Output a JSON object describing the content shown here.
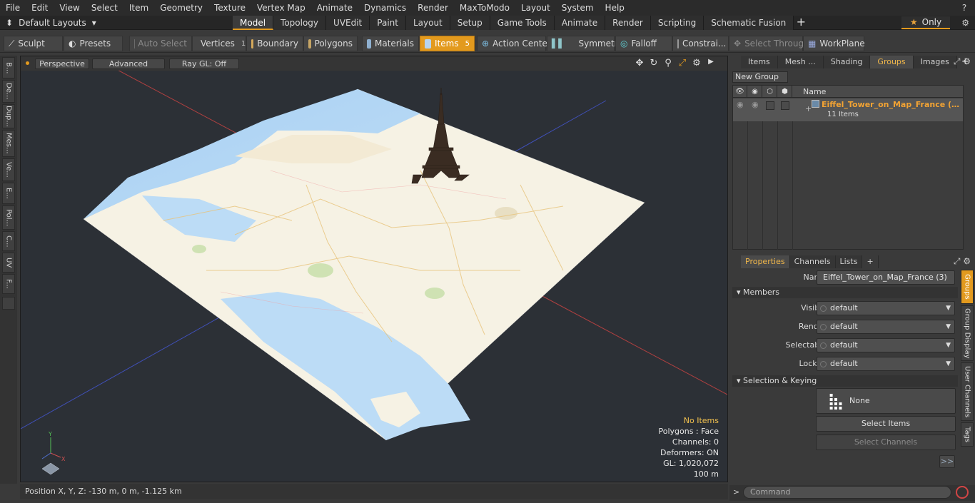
{
  "menu": [
    "File",
    "Edit",
    "View",
    "Select",
    "Item",
    "Geometry",
    "Texture",
    "Vertex Map",
    "Animate",
    "Dynamics",
    "Render",
    "MaxToModo",
    "Layout",
    "System",
    "Help"
  ],
  "layout": {
    "name": "Default Layouts",
    "tabs": [
      "Model",
      "Topology",
      "UVEdit",
      "Paint",
      "Layout",
      "Setup",
      "Game Tools",
      "Animate",
      "Render",
      "Scripting",
      "Schematic Fusion"
    ],
    "active_tab": "Model",
    "only_label": "Only"
  },
  "toolbar": {
    "sculpt": "Sculpt",
    "presets": "Presets",
    "auto_select": "Auto Select",
    "vertices": "Vertices",
    "vertices_count": "1",
    "boundary": "Boundary",
    "polygons": "Polygons",
    "materials": "Materials",
    "items": "Items",
    "items_count": "5",
    "action_center": "Action Center",
    "symmetry": "Symmetry",
    "falloff": "Falloff",
    "constraints": "Constrai...",
    "select_through": "Select Through",
    "workplane": "WorkPlane"
  },
  "left_tabs": [
    "B...",
    "De...",
    "Dup...",
    "Mes...",
    "Ve...",
    "E...",
    "Pol...",
    "C...",
    "UV",
    "F..."
  ],
  "viewport": {
    "view": "Perspective",
    "shading": "Advanced",
    "raygl": "Ray GL: Off",
    "stats": {
      "items": "No Items",
      "polygons": "Polygons : Face",
      "channels": "Channels: 0",
      "deformers": "Deformers: ON",
      "gl": "GL: 1,020,072",
      "scale": "100 m"
    }
  },
  "status": {
    "position": "Position X, Y, Z:  -130 m, 0 m, -1.125 km"
  },
  "groups_panel": {
    "tabs": [
      "Items",
      "Mesh ...",
      "Shading",
      "Groups",
      "Images"
    ],
    "active": "Groups",
    "new_group": "New Group",
    "name_header": "Name",
    "group": {
      "name": "Eiffel_Tower_on_Map_France (3...",
      "count": "11 Items"
    }
  },
  "properties": {
    "tabs": [
      "Properties",
      "Channels",
      "Lists"
    ],
    "active": "Properties",
    "name_label": "Name",
    "name_value": "Eiffel_Tower_on_Map_France (3)",
    "members_section": "Members",
    "visible_label": "Visible",
    "visible_value": "default",
    "render_label": "Render",
    "render_value": "default",
    "selectable_label": "Selectable",
    "selectable_value": "default",
    "locked_label": "Locked",
    "locked_value": "default",
    "sel_section": "Selection & Keying",
    "none_label": "None",
    "select_items": "Select Items",
    "select_channels": "Select Channels",
    "more": ">>",
    "side_tabs": [
      "Groups",
      "Group Display",
      "User Channels",
      "Tags"
    ]
  },
  "command": {
    "placeholder": "Command",
    "prompt": ">"
  }
}
